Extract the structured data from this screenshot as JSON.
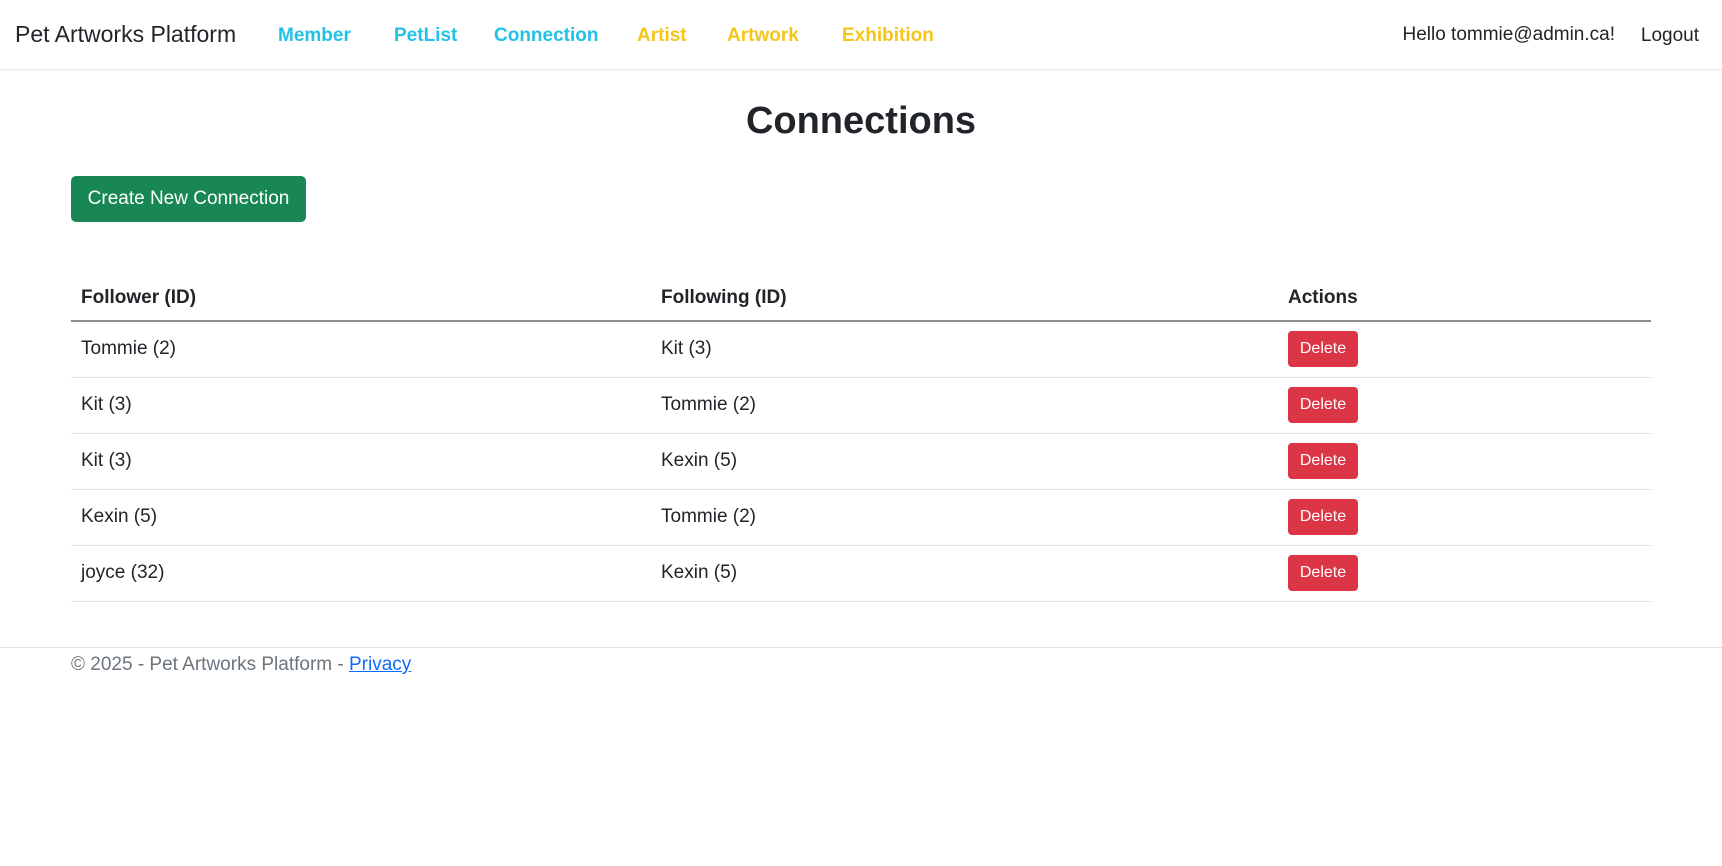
{
  "nav": {
    "brand": "Pet Artworks Platform",
    "links": [
      {
        "label": "Member",
        "color": "#22c1e6"
      },
      {
        "label": "PetList",
        "color": "#22c1e6"
      },
      {
        "label": "Connection",
        "color": "#22c1e6"
      },
      {
        "label": "Artist",
        "color": "#f5c518"
      },
      {
        "label": "Artwork",
        "color": "#f5c518"
      },
      {
        "label": "Exhibition",
        "color": "#f5c518"
      }
    ],
    "greeting": "Hello tommie@admin.ca!",
    "logout_label": "Logout"
  },
  "main": {
    "title": "Connections",
    "create_button": "Create New Connection",
    "create_button_color": "#198754",
    "table": {
      "headers": [
        "Follower (ID)",
        "Following (ID)",
        "Actions"
      ],
      "rows": [
        {
          "follower": "Tommie (2)",
          "following": "Kit (3)",
          "action": "Delete"
        },
        {
          "follower": "Kit (3)",
          "following": "Tommie (2)",
          "action": "Delete"
        },
        {
          "follower": "Kit (3)",
          "following": "Kexin (5)",
          "action": "Delete"
        },
        {
          "follower": "Kexin (5)",
          "following": "Tommie (2)",
          "action": "Delete"
        },
        {
          "follower": "joyce (32)",
          "following": "Kexin (5)",
          "action": "Delete"
        }
      ],
      "delete_color": "#dc3545"
    }
  },
  "footer": {
    "text": "© 2025 - Pet Artworks Platform - ",
    "privacy_label": "Privacy"
  }
}
